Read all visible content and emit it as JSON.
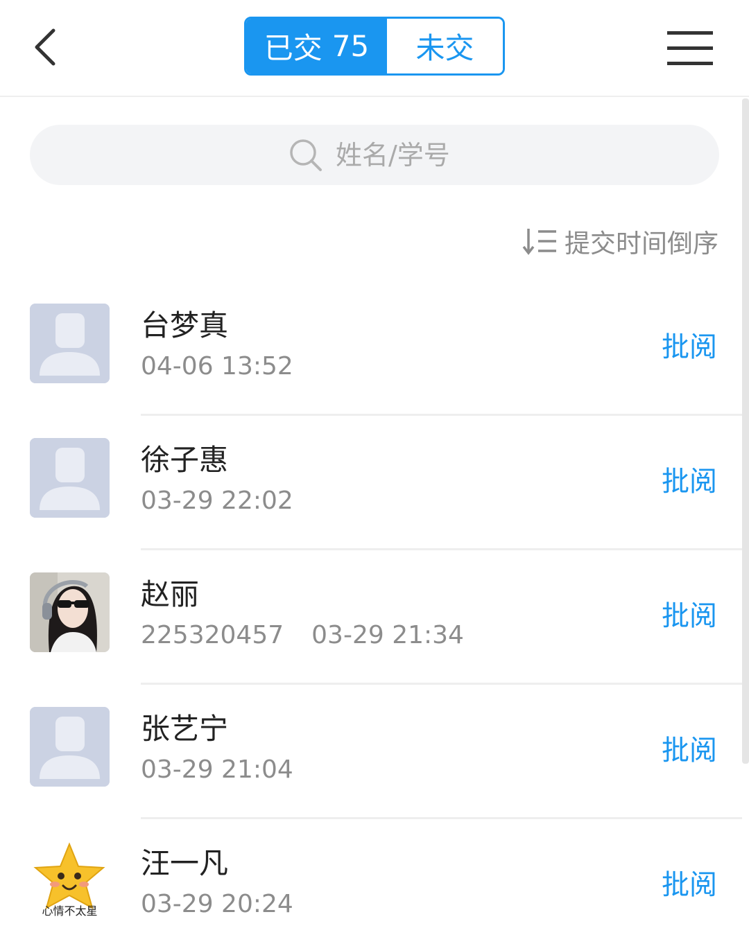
{
  "header": {
    "back_icon": "chevron-left-icon",
    "tab_submitted_label": "已交",
    "tab_submitted_count": "75",
    "tab_unsubmitted_label": "未交",
    "menu_icon": "hamburger-menu-icon",
    "accent_color": "#1a96f0"
  },
  "search": {
    "placeholder": "姓名/学号",
    "icon": "search-icon"
  },
  "sort": {
    "label": "提交时间倒序",
    "icon": "sort-descending-icon"
  },
  "students": [
    {
      "name": "台梦真",
      "student_id": "",
      "time": "04-06 13:52",
      "action": "批阅",
      "avatar": "default-avatar"
    },
    {
      "name": "徐子惠",
      "student_id": "",
      "time": "03-29 22:02",
      "action": "批阅",
      "avatar": "default-avatar"
    },
    {
      "name": "赵丽",
      "student_id": "225320457",
      "time": "03-29 21:34",
      "action": "批阅",
      "avatar": "photo-avatar"
    },
    {
      "name": "张艺宁",
      "student_id": "",
      "time": "03-29 21:04",
      "action": "批阅",
      "avatar": "default-avatar"
    },
    {
      "name": "汪一凡",
      "student_id": "",
      "time": "03-29 20:24",
      "action": "批阅",
      "avatar": "star-sticker-avatar",
      "avatar_caption": "心情不太星"
    }
  ]
}
